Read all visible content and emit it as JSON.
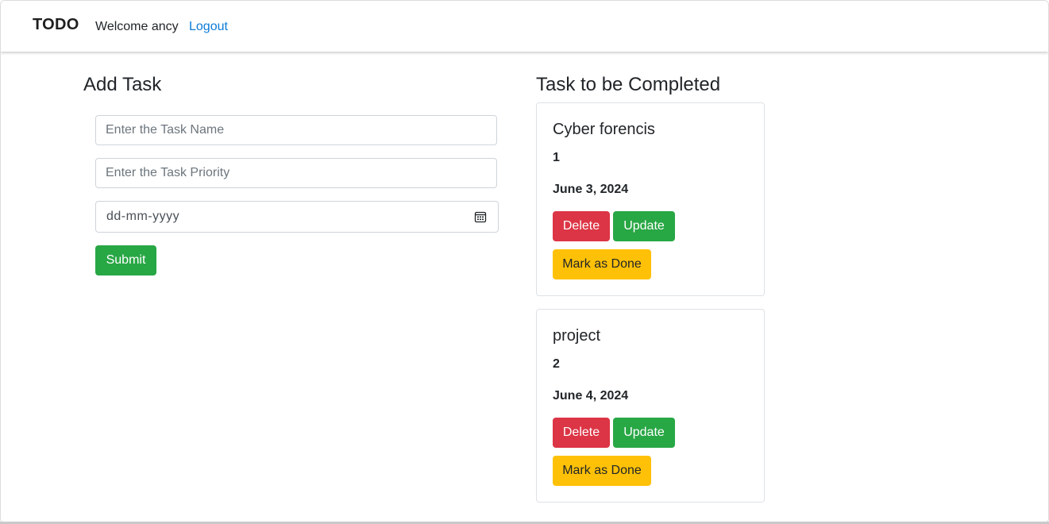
{
  "navbar": {
    "brand": "TODO",
    "welcome": "Welcome ancy",
    "logout": "Logout"
  },
  "add_task": {
    "heading": "Add Task",
    "task_name_placeholder": "Enter the Task Name",
    "task_name_value": "",
    "task_priority_placeholder": "Enter the Task Priority",
    "task_priority_value": "",
    "date_placeholder": "dd-mm-yyyy",
    "submit_label": "Submit"
  },
  "task_list": {
    "heading": "Task to be Completed",
    "tasks": [
      {
        "name": "Cyber forencis",
        "priority": "1",
        "date": "June 3, 2024",
        "delete_label": "Delete",
        "update_label": "Update",
        "done_label": "Mark as Done"
      },
      {
        "name": "project",
        "priority": "2",
        "date": "June 4, 2024",
        "delete_label": "Delete",
        "update_label": "Update",
        "done_label": "Mark as Done"
      }
    ]
  },
  "icons": {
    "calendar": "calendar-icon"
  },
  "colors": {
    "success": "#28a745",
    "danger": "#dc3545",
    "warning": "#ffc107",
    "link": "#0d7bd6"
  }
}
